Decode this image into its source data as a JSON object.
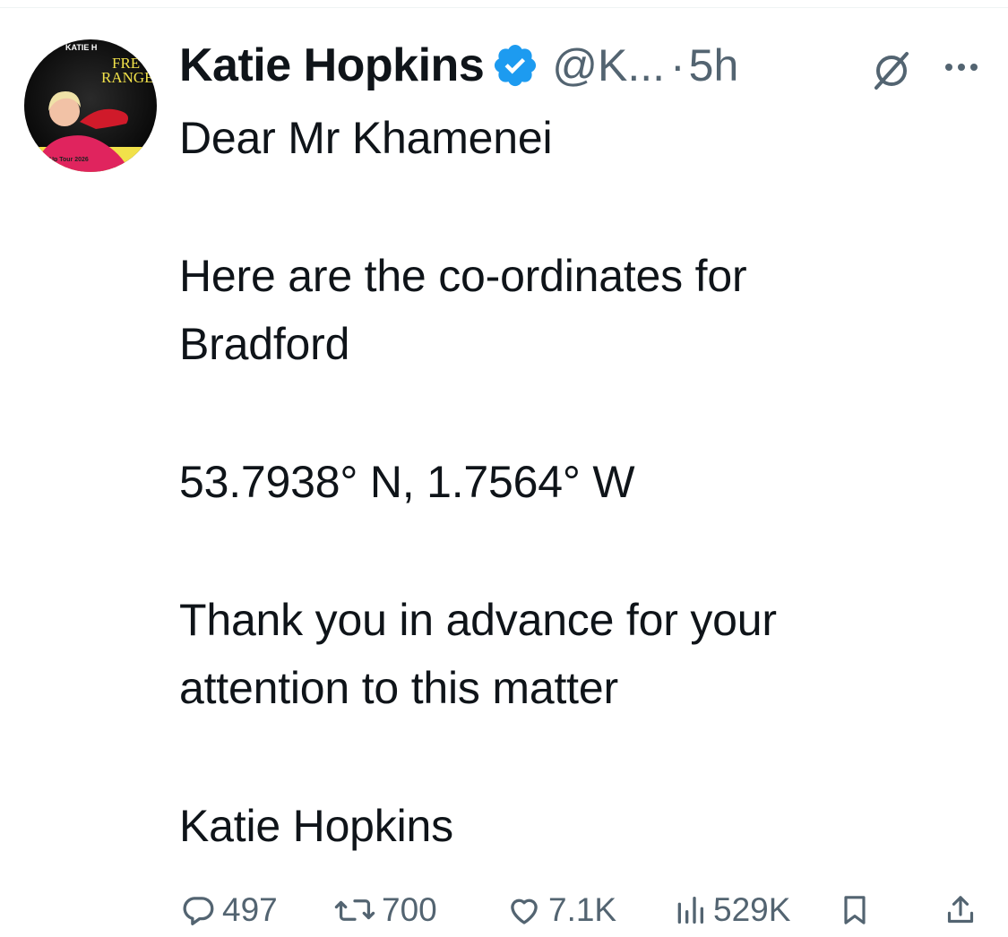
{
  "tweet": {
    "author": {
      "display_name": "Katie Hopkins",
      "handle": "@K...",
      "verified": true,
      "avatar_text": {
        "top_arc": "KATIE H",
        "line1": "FRE",
        "line2": "RANGE",
        "banner": "Up Tour 2026"
      }
    },
    "separator": "·",
    "time": "5h",
    "lines": [
      "Dear Mr Khamenei",
      "Here are the co-ordinates for",
      "Bradford",
      "53.7938° N, 1.7564° W",
      "Thank you in advance for your",
      "attention to this matter",
      "Katie Hopkins"
    ],
    "stats": {
      "replies": "497",
      "reposts": "700",
      "likes": "7.1K",
      "views": "529K"
    }
  },
  "colors": {
    "text": "#0f1419",
    "secondary": "#536471",
    "verified_blue": "#1d9bf0"
  },
  "icons": [
    "grok-icon",
    "more-icon",
    "reply-icon",
    "repost-icon",
    "like-icon",
    "views-icon",
    "bookmark-icon",
    "share-icon"
  ]
}
